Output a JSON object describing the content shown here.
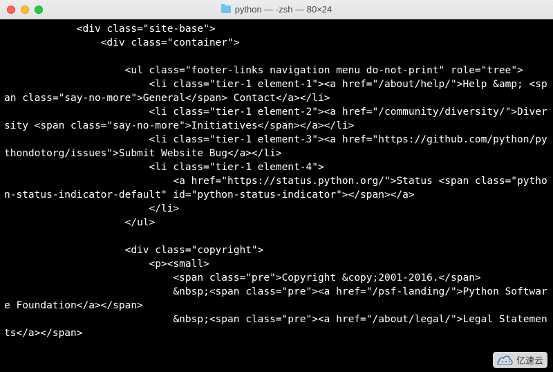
{
  "titlebar": {
    "title": "python — -zsh — 80×24"
  },
  "terminal": {
    "content": "            <div class=\"site-base\">\n                <div class=\"container\">\n\n                    <ul class=\"footer-links navigation menu do-not-print\" role=\"tree\">\n                        <li class=\"tier-1 element-1\"><a href=\"/about/help/\">Help &amp; <span class=\"say-no-more\">General</span> Contact</a></li>\n                        <li class=\"tier-1 element-2\"><a href=\"/community/diversity/\">Diversity <span class=\"say-no-more\">Initiatives</span></a></li>\n                        <li class=\"tier-1 element-3\"><a href=\"https://github.com/python/pythondotorg/issues\">Submit Website Bug</a></li>\n                        <li class=\"tier-1 element-4\">\n                            <a href=\"https://status.python.org/\">Status <span class=\"python-status-indicator-default\" id=\"python-status-indicator\"></span></a>\n                        </li>\n                    </ul>\n\n                    <div class=\"copyright\">\n                        <p><small>\n                            <span class=\"pre\">Copyright &copy;2001-2016.</span>\n                            &nbsp;<span class=\"pre\"><a href=\"/psf-landing/\">Python Software Foundation</a></span>\n                            &nbsp;<span class=\"pre\"><a href=\"/about/legal/\">Legal Statements</a></span>"
  },
  "watermark": {
    "text": "亿速云"
  }
}
